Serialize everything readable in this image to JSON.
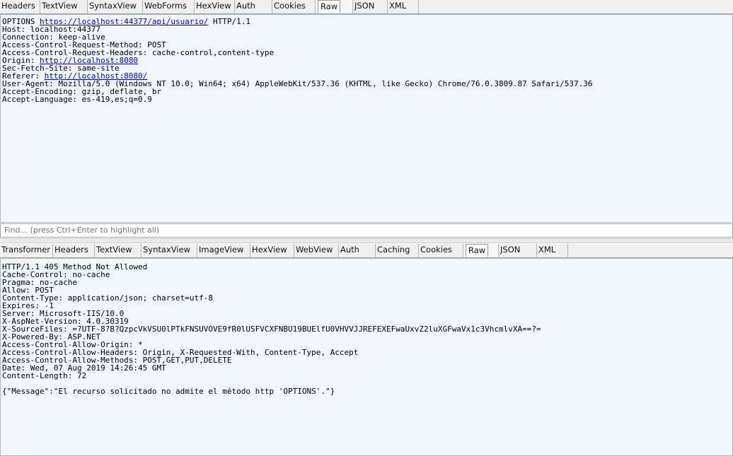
{
  "request_tabs": [
    "Headers",
    "TextView",
    "SyntaxView",
    "WebForms",
    "HexView",
    "Auth",
    "Cookies",
    "Raw",
    "JSON",
    "XML"
  ],
  "request_active_tab": "Raw",
  "request": {
    "method": "OPTIONS",
    "url": "https://localhost:44377/api/usuario/",
    "version": "HTTP/1.1",
    "host": "Host: localhost:44377",
    "connection": "Connection: keep-alive",
    "acr_method": "Access-Control-Request-Method: POST",
    "acr_headers": "Access-Control-Request-Headers: cache-control,content-type",
    "origin_label": "Origin: ",
    "origin_url": "http://localhost:8080",
    "sec_fetch": "Sec-Fetch-Site: same-site",
    "referer_label": "Referer: ",
    "referer_url": "http://localhost:8080/",
    "user_agent": "User-Agent: Mozilla/5.0 (Windows NT 10.0; Win64; x64) AppleWebKit/537.36 (KHTML, like Gecko) Chrome/76.0.3809.87 Safari/537.36",
    "accept_encoding": "Accept-Encoding: gzip, deflate, br",
    "accept_language": "Accept-Language: es-419,es;q=0.9"
  },
  "find_placeholder": "Find... (press Ctrl+Enter to highlight all)",
  "response_tabs": [
    "Transformer",
    "Headers",
    "TextView",
    "SyntaxView",
    "ImageView",
    "HexView",
    "WebView",
    "Auth",
    "Caching",
    "Cookies",
    "Raw",
    "JSON",
    "XML"
  ],
  "response_active_tab": "Raw",
  "response_lines": [
    "HTTP/1.1 405 Method Not Allowed",
    "Cache-Control: no-cache",
    "Pragma: no-cache",
    "Allow: POST",
    "Content-Type: application/json; charset=utf-8",
    "Expires: -1",
    "Server: Microsoft-IIS/10.0",
    "X-AspNet-Version: 4.0.30319",
    "X-SourceFiles: =?UTF-8?B?QzpcVkVSU0lPTkFNSUVOVE9fR0lUSFVCXFNBU19BUElfU0VHVVJJREFEXEFwaUxvZ2luXGFwaVx1c3VhcmlvXA==?=",
    "X-Powered-By: ASP.NET",
    "Access-Control-Allow-Origin: *",
    "Access-Control-Allow-Headers: Origin, X-Requested-With, Content-Type, Accept",
    "Access-Control-Allow-Methods: POST,GET,PUT,DELETE",
    "Date: Wed, 07 Aug 2019 14:26:45 GMT",
    "Content-Length: 72",
    "",
    "{\"Message\":\"El recurso solicitado no admite el método http 'OPTIONS'.\"}"
  ]
}
